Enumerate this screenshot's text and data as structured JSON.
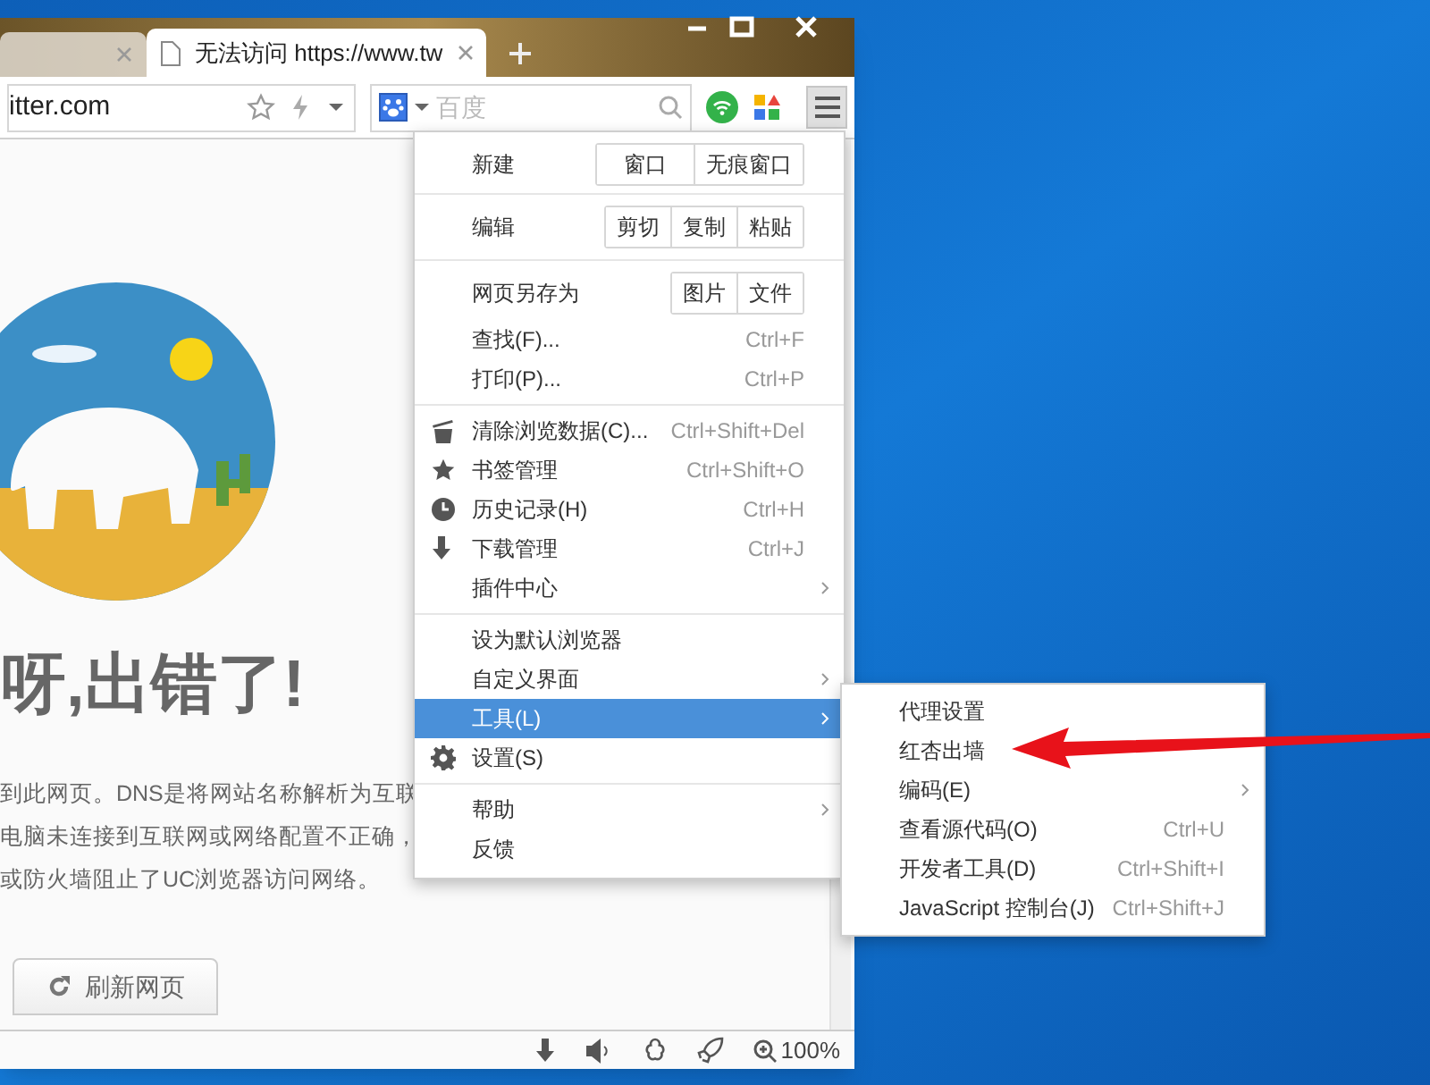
{
  "tabs": [
    {
      "selected": false
    },
    {
      "title": "无法访问 https://www.tw",
      "selected": true
    }
  ],
  "address_bar": {
    "url": "itter.com"
  },
  "search": {
    "placeholder": "百度"
  },
  "page": {
    "heading": "呀,出错了!",
    "lines": [
      "到此网页。DNS是将网站名称解析为互联",
      "电脑未连接到互联网或网络配置不正确，",
      "或防火墙阻止了UC浏览器访问网络。"
    ],
    "refresh_button": "刷新网页"
  },
  "menu": {
    "sections": [
      [
        {
          "kind": "buttons",
          "label": "新建",
          "buttons": [
            "窗口",
            "无痕窗口"
          ]
        }
      ],
      [
        {
          "kind": "buttons",
          "label": "编辑",
          "buttons": [
            "剪切",
            "复制",
            "粘贴"
          ]
        }
      ],
      [
        {
          "kind": "buttons",
          "label": "网页另存为",
          "buttons": [
            "图片",
            "文件"
          ]
        },
        {
          "kind": "item",
          "label": "查找(F)...",
          "shortcut": "Ctrl+F",
          "submenu": false,
          "selected": false
        },
        {
          "kind": "item",
          "label": "打印(P)...",
          "shortcut": "Ctrl+P",
          "submenu": false,
          "selected": false
        }
      ],
      [
        {
          "kind": "item",
          "label": "清除浏览数据(C)...",
          "shortcut": "Ctrl+Shift+Del",
          "submenu": false,
          "selected": false
        },
        {
          "kind": "item",
          "label": "书签管理",
          "shortcut": "Ctrl+Shift+O",
          "submenu": false,
          "selected": false
        },
        {
          "kind": "item",
          "label": "历史记录(H)",
          "shortcut": "Ctrl+H",
          "submenu": false,
          "selected": false
        },
        {
          "kind": "item",
          "label": "下载管理",
          "shortcut": "Ctrl+J",
          "submenu": false,
          "selected": false
        },
        {
          "kind": "item",
          "label": "插件中心",
          "submenu": true,
          "selected": false
        }
      ],
      [
        {
          "kind": "item",
          "label": "设为默认浏览器",
          "submenu": false,
          "selected": false
        },
        {
          "kind": "item",
          "label": "自定义界面",
          "submenu": true,
          "selected": false
        },
        {
          "kind": "item",
          "label": "工具(L)",
          "submenu": true,
          "selected": true
        },
        {
          "kind": "item",
          "label": "设置(S)",
          "submenu": false,
          "selected": false
        }
      ],
      [
        {
          "kind": "item",
          "label": "帮助",
          "submenu": true,
          "selected": false
        },
        {
          "kind": "item",
          "label": "反馈",
          "submenu": false,
          "selected": false
        }
      ]
    ]
  },
  "submenu": {
    "items": [
      {
        "label": "代理设置",
        "submenu": false
      },
      {
        "label": "红杏出墙",
        "submenu": false
      },
      {
        "label": "编码(E)",
        "submenu": true
      },
      {
        "label": "查看源代码(O)",
        "shortcut": "Ctrl+U",
        "submenu": false
      },
      {
        "label": "开发者工具(D)",
        "shortcut": "Ctrl+Shift+I",
        "submenu": false
      },
      {
        "label": "JavaScript 控制台(J)",
        "shortcut": "Ctrl+Shift+J",
        "submenu": false
      }
    ]
  },
  "status_bar": {
    "zoom": "100%"
  }
}
